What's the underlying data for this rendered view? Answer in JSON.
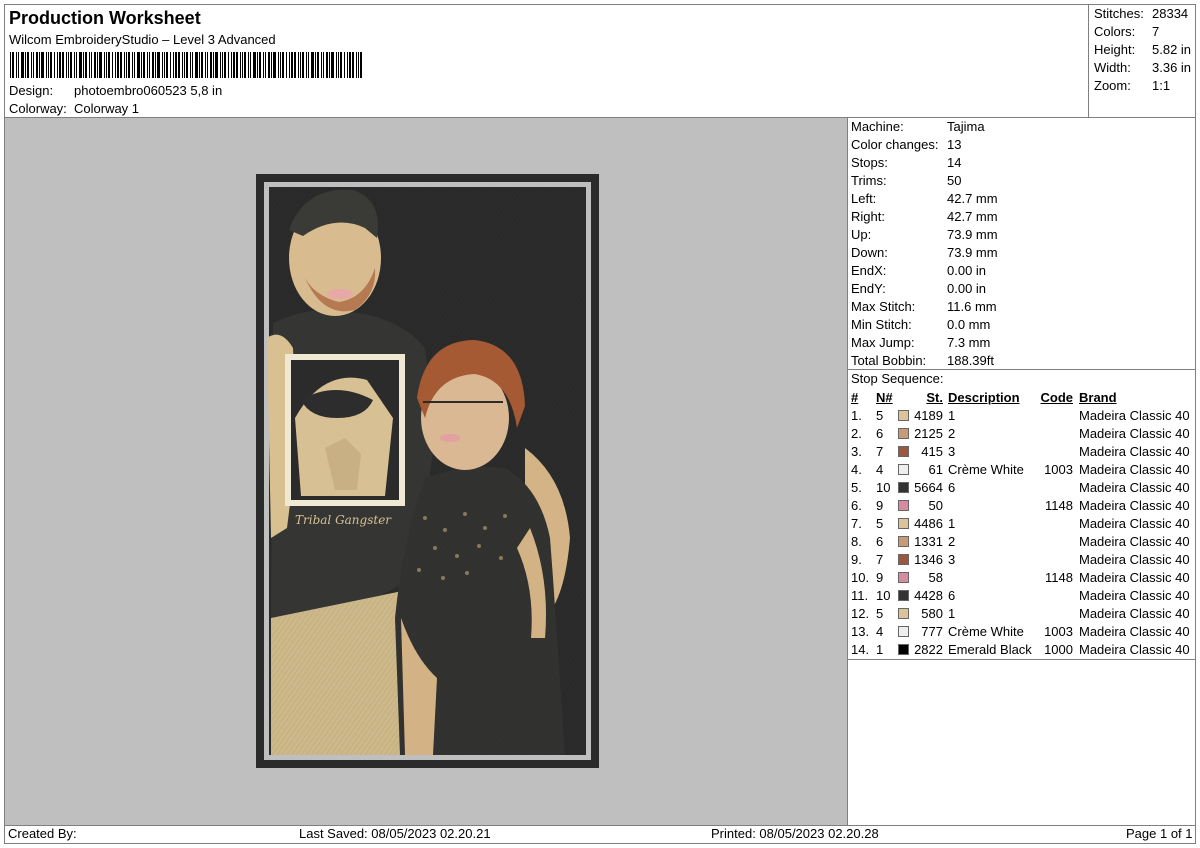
{
  "header": {
    "title": "Production Worksheet",
    "subtitle": "Wilcom EmbroideryStudio – Level 3 Advanced",
    "design_label": "Design:",
    "design_value": "photoembro060523 5,8 in",
    "colorway_label": "Colorway:",
    "colorway_value": "Colorway 1"
  },
  "stats": [
    {
      "label": "Stitches:",
      "value": "28334"
    },
    {
      "label": "Colors:",
      "value": "7"
    },
    {
      "label": "Height:",
      "value": "5.82 in"
    },
    {
      "label": "Width:",
      "value": "3.36 in"
    },
    {
      "label": "Zoom:",
      "value": "1:1"
    }
  ],
  "machine_info": [
    {
      "label": "Machine:",
      "value": "Tajima"
    },
    {
      "label": "Color changes:",
      "value": "13"
    },
    {
      "label": "Stops:",
      "value": "14"
    },
    {
      "label": "Trims:",
      "value": "50"
    },
    {
      "label": "Left:",
      "value": "42.7 mm"
    },
    {
      "label": "Right:",
      "value": "42.7 mm"
    },
    {
      "label": "Up:",
      "value": "73.9 mm"
    },
    {
      "label": "Down:",
      "value": "73.9 mm"
    },
    {
      "label": "EndX:",
      "value": "0.00 in"
    },
    {
      "label": "EndY:",
      "value": "0.00 in"
    },
    {
      "label": "Max Stitch:",
      "value": "11.6 mm"
    },
    {
      "label": "Min Stitch:",
      "value": "0.0 mm"
    },
    {
      "label": "Max Jump:",
      "value": "7.3 mm"
    },
    {
      "label": "Total Bobbin:",
      "value": "188.39ft"
    }
  ],
  "stop_sequence": {
    "title": "Stop Sequence:",
    "columns": {
      "num": "#",
      "n": "N#",
      "st": "St.",
      "desc": "Description",
      "code": "Code",
      "brand": "Brand"
    },
    "rows": [
      {
        "num": "1.",
        "n": "5",
        "color": "#dcc39a",
        "st": "4189",
        "desc": "1",
        "code": "",
        "brand": "Madeira Classic 40"
      },
      {
        "num": "2.",
        "n": "6",
        "color": "#c99a78",
        "st": "2125",
        "desc": "2",
        "code": "",
        "brand": "Madeira Classic 40"
      },
      {
        "num": "3.",
        "n": "7",
        "color": "#9a5840",
        "st": "415",
        "desc": "3",
        "code": "",
        "brand": "Madeira Classic 40"
      },
      {
        "num": "4.",
        "n": "4",
        "color": "#eeeeee",
        "st": "61",
        "desc": "Crème White",
        "code": "1003",
        "brand": "Madeira Classic 40"
      },
      {
        "num": "5.",
        "n": "10",
        "color": "#333333",
        "st": "5664",
        "desc": "6",
        "code": "",
        "brand": "Madeira Classic 40"
      },
      {
        "num": "6.",
        "n": "9",
        "color": "#d88aa0",
        "st": "50",
        "desc": "",
        "code": "1148",
        "brand": "Madeira Classic 40"
      },
      {
        "num": "7.",
        "n": "5",
        "color": "#dcc39a",
        "st": "4486",
        "desc": "1",
        "code": "",
        "brand": "Madeira Classic 40"
      },
      {
        "num": "8.",
        "n": "6",
        "color": "#c99a78",
        "st": "1331",
        "desc": "2",
        "code": "",
        "brand": "Madeira Classic 40"
      },
      {
        "num": "9.",
        "n": "7",
        "color": "#9a5840",
        "st": "1346",
        "desc": "3",
        "code": "",
        "brand": "Madeira Classic 40"
      },
      {
        "num": "10.",
        "n": "9",
        "color": "#d88aa0",
        "st": "58",
        "desc": "",
        "code": "1148",
        "brand": "Madeira Classic 40"
      },
      {
        "num": "11.",
        "n": "10",
        "color": "#333333",
        "st": "4428",
        "desc": "6",
        "code": "",
        "brand": "Madeira Classic 40"
      },
      {
        "num": "12.",
        "n": "5",
        "color": "#dcc39a",
        "st": "580",
        "desc": "1",
        "code": "",
        "brand": "Madeira Classic 40"
      },
      {
        "num": "13.",
        "n": "4",
        "color": "#eeeeee",
        "st": "777",
        "desc": "Crème White",
        "code": "1003",
        "brand": "Madeira Classic 40"
      },
      {
        "num": "14.",
        "n": "1",
        "color": "#000000",
        "st": "2822",
        "desc": "Emerald Black",
        "code": "1000",
        "brand": "Madeira Classic 40"
      }
    ]
  },
  "design_image": {
    "shirt_text": "Tribal Gangster"
  },
  "footer": {
    "created_by": "Created By:",
    "last_saved": "Last Saved: 08/05/2023 02.20.21",
    "printed": "Printed: 08/05/2023 02.20.28",
    "page": "Page 1 of 1"
  }
}
